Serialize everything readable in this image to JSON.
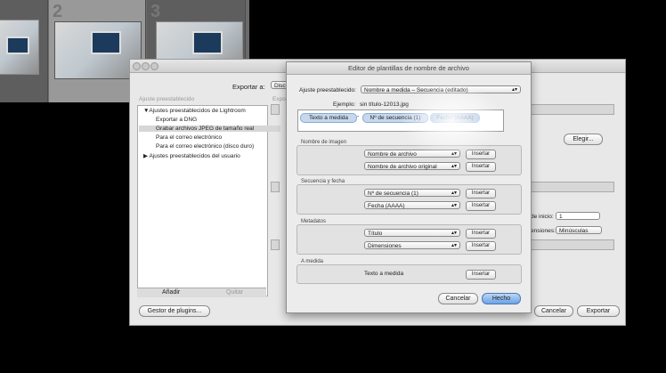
{
  "filmstrip": {
    "frame_numbers": [
      "",
      "2",
      "3"
    ]
  },
  "export": {
    "export_to_label": "Exportar a:",
    "export_to_value": "Disc",
    "presets_header": "Ajuste preestablecido",
    "sub_header": "Expor",
    "tree": [
      "▼Ajustes preestablecidos de Lightroom",
      "Exportar a DNG",
      "Grabar archivos JPEG de tamaño real",
      "Para el correo electrónico",
      "Para el correo electrónico (disco duro)",
      "▶ Ajustes preestablecidos del usuario"
    ],
    "add_label": "Añadir",
    "remove_label": "Quitar",
    "plugins_button": "Gestor de plugins...",
    "cancel_button": "Cancelar",
    "export_button": "Exportar",
    "choose_button": "Elegir...",
    "start_label": "de inicio:",
    "start_value": "1",
    "extensions_label": "ensiones:",
    "extensions_value": "Minúsculas"
  },
  "dialog": {
    "title": "Editor de plantillas de nombre de archivo",
    "preset_label": "Ajuste preestablecido:",
    "preset_value": "Nombre a medida – Secuencia (editado)",
    "example_label": "Ejemplo:",
    "example_value": "sin título-12013.jpg",
    "tokens": [
      "Texto a medida",
      "-",
      "Nº de secuencia (1)",
      "Fecha (AAAA)"
    ],
    "sections": {
      "image_name": {
        "label": "Nombre de imagen",
        "rows": [
          "Nombre de archivo",
          "Nombre de archivo original"
        ]
      },
      "sequence_date": {
        "label": "Secuencia y fecha",
        "rows": [
          "Nº de secuencia (1)",
          "Fecha (AAAA)"
        ]
      },
      "metadata": {
        "label": "Metadatos",
        "rows": [
          "Título",
          "Dimensiones"
        ]
      },
      "custom": {
        "label": "A medida",
        "text": "Texto a medida"
      }
    },
    "insert_label": "Insertar",
    "cancel_button": "Cancelar",
    "done_button": "Hecho"
  }
}
